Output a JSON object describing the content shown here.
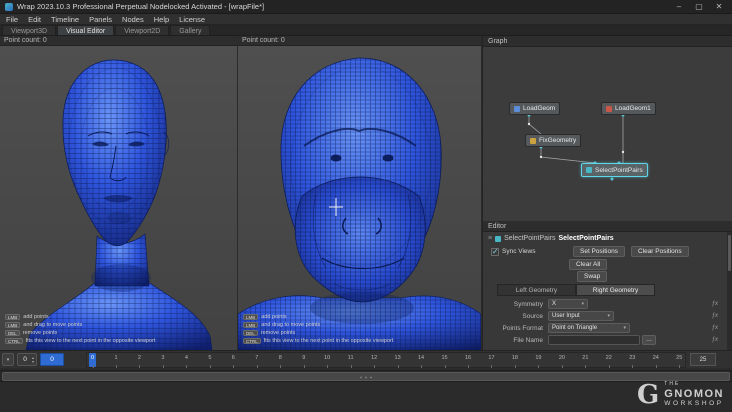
{
  "window": {
    "title": "Wrap 2023.10.3  Professional Perpetual Nodelocked Activated - [wrapFile*]",
    "controls": {
      "minimize": "–",
      "maximize": "▢",
      "close": "✕"
    }
  },
  "menu": [
    "File",
    "Edit",
    "Timeline",
    "Panels",
    "Nodes",
    "Help",
    "License"
  ],
  "tabs": [
    "Viewport3D",
    "Visual Editor",
    "Viewport2D",
    "Gallery"
  ],
  "viewports": {
    "left": {
      "point_count": "Point count: 0"
    },
    "right": {
      "point_count": "Point count: 0"
    },
    "hints": [
      {
        "key": "LMB",
        "text": "add points"
      },
      {
        "key": "LMB",
        "text": "and drag to move points"
      },
      {
        "key": "DEL",
        "text": "remove points"
      },
      {
        "key": "CTRL",
        "text": "fits this view to the next point in the opposite viewport"
      }
    ]
  },
  "graph": {
    "title": "Graph",
    "nodes": [
      {
        "name": "LoadGeom"
      },
      {
        "name": "LoadGeom1"
      },
      {
        "name": "FixGeometry"
      },
      {
        "name": "SelectPointPairs",
        "selected": true
      }
    ]
  },
  "editor": {
    "title": "Editor",
    "node_type": "SelectPointPairs",
    "node_name": "SelectPointPairs",
    "sync_views_label": "Sync Views",
    "buttons": {
      "set_positions": "Set Positions",
      "clear_positions": "Clear Positions",
      "clear_all": "Clear All",
      "swap": "Swap"
    },
    "geometry_tabs": [
      "Left Geometry",
      "Right Geometry"
    ],
    "fields": [
      {
        "label": "Symmetry",
        "value": "X"
      },
      {
        "label": "Source",
        "value": "User Input"
      },
      {
        "label": "Points Format",
        "value": "Point on Triangle"
      },
      {
        "label": "File Name",
        "value": ""
      }
    ],
    "browse_label": "…",
    "fx_label": "ƒx"
  },
  "timeline": {
    "current_frame": "0",
    "spin_value": "0",
    "end_frame": "25",
    "ticks": [
      "0",
      "1",
      "2",
      "3",
      "4",
      "5",
      "6",
      "7",
      "8",
      "9",
      "10",
      "11",
      "12",
      "13",
      "14",
      "15",
      "16",
      "17",
      "18",
      "19",
      "20",
      "21",
      "22",
      "23",
      "24",
      "25"
    ]
  },
  "logo": {
    "g": "G",
    "the": "THE",
    "gnomon": "GNOMON",
    "workshop": "WORKSHOP"
  },
  "icons": {
    "check": "✓",
    "chevron_down": "▾",
    "spin_up": "▴",
    "spin_down": "▾",
    "grip": "≡"
  },
  "colors": {
    "accent_blue": "#2e6bd3",
    "selection_teal": "#5fd7ea",
    "mesh_blue": "#2f55dd",
    "node_loadgeom": "#5b8dd9",
    "node_loadgeom1": "#c8574a",
    "node_fixgeometry": "#c9a23f",
    "node_selectpointpairs": "#49b8c4"
  }
}
